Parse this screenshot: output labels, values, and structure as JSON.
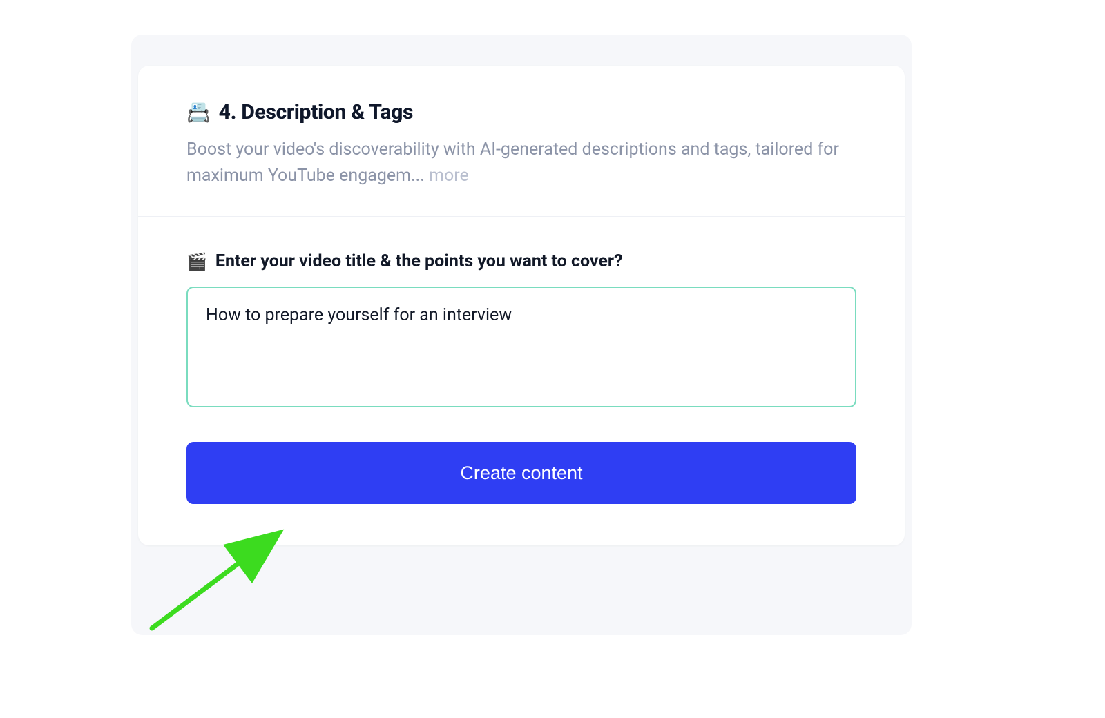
{
  "section": {
    "icon": "📇",
    "title": "4. Description & Tags",
    "description_truncated": "Boost your video's discoverability with AI-generated descriptions and tags, tailored for maximum YouTube engagem...",
    "more_label": "more"
  },
  "form": {
    "label_icon": "🎬",
    "label_text": "Enter your video title & the points you want to cover?",
    "textarea_value": "How to prepare yourself for an interview",
    "submit_label": "Create content"
  },
  "annotation": {
    "arrow_color": "#3cdb1f"
  }
}
